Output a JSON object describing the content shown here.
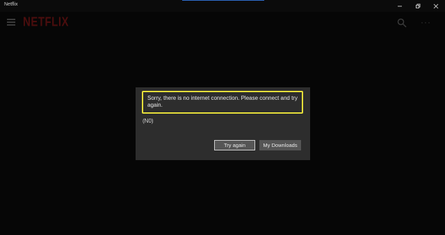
{
  "window": {
    "title": "Netflix"
  },
  "appbar": {
    "logo_text": "NETFLIX",
    "menu_icon": "hamburger-icon",
    "search_icon": "search-icon",
    "more_icon": "more-icon"
  },
  "dialog": {
    "message": "Sorry, there is no internet connection. Please connect and try again.",
    "error_code": "(N0)",
    "try_again_label": "Try again",
    "downloads_label": "My Downloads"
  },
  "colors": {
    "background": "#060606",
    "dialog_bg": "#2d2d2d",
    "highlight_border": "#e6df3a",
    "button_bg": "#555555",
    "logo": "#4a0d0d"
  }
}
